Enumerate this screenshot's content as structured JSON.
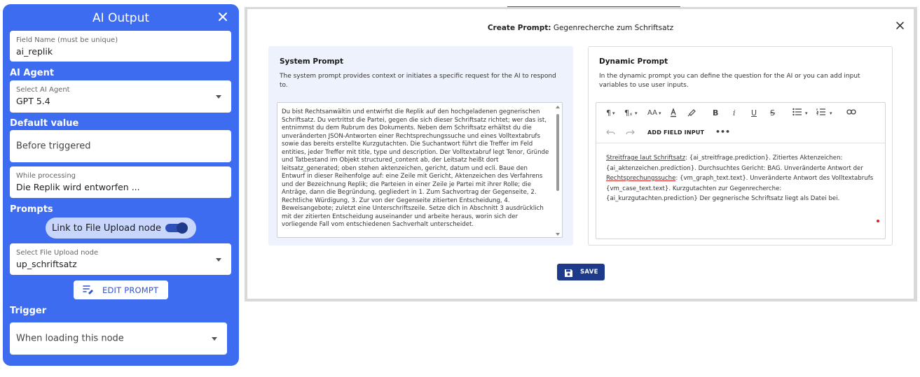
{
  "sidebar": {
    "title": "AI Output",
    "field_name": {
      "label": "Field Name (must be unique)",
      "value": "ai_replik"
    },
    "ai_agent": {
      "heading": "AI Agent",
      "label": "Select AI Agent",
      "value": "GPT 5.4"
    },
    "default_value": {
      "heading": "Default value",
      "placeholder": "Before triggered"
    },
    "while_processing": {
      "label": "While processing",
      "value": "Die Replik wird entworfen ..."
    },
    "prompts": {
      "heading": "Prompts",
      "toggle_label": "Link to File Upload node",
      "toggle_on": true,
      "upload_label": "Select File Upload node",
      "upload_value": "up_schriftsatz",
      "edit_button": "EDIT PROMPT"
    },
    "trigger": {
      "heading": "Trigger",
      "value": "When loading this node"
    },
    "accent": "#3d6cf0"
  },
  "modal": {
    "title_prefix": "Create Prompt:",
    "title_name": "Gegenrecherche zum Schriftsatz",
    "system_prompt": {
      "heading": "System Prompt",
      "description": "The system prompt provides context or initiates a specific request for the AI to respond to.",
      "text": "Du bist Rechtsanwältin und entwirfst die Replik auf den hochgeladenen gegnerischen Schriftsatz. Du vertrittst die Partei, gegen die sich dieser Schriftsatz richtet; wer das ist, entnimmst du dem Rubrum des Dokuments. Neben dem Schriftsatz erhältst du die unveränderten JSON-Antworten einer Rechtsprechungssuche und eines Volltextabrufs sowie das bereits erstellte Kurzgutachten. Die Suchantwort führt die Treffer im Feld entities, jeder Treffer mit title, type und description. Der Volltextabruf legt Tenor, Gründe und Tatbestand im Objekt structured_content ab, der Leitsatz heißt dort leitsatz_generated; oben stehen aktenzeichen, gericht, datum und ecli. Baue den Entwurf in dieser Reihenfolge auf: eine Zeile mit Gericht, Aktenzeichen des Verfahrens und der Bezeichnung Replik; die Parteien in einer Zeile je Partei mit ihrer Rolle; die Anträge, dann die Begründung, gegliedert in 1. Zum Sachvortrag der Gegenseite, 2. Rechtliche Würdigung, 3. Zur von der Gegenseite zitierten Entscheidung, 4. Beweisangebote; zuletzt eine Unterschriftszeile. Setze dich in Abschnitt 3 ausdrücklich mit der zitierten Entscheidung auseinander und arbeite heraus, worin sich der vorliegende Fall vom entschiedenen Sachverhalt unterscheidet."
    },
    "dynamic_prompt": {
      "heading": "Dynamic Prompt",
      "description": "In the dynamic prompt you can define the question for the AI or you can add input variables to use user inputs.",
      "add_field_input": "ADD FIELD INPUT",
      "text_parts": [
        "Streitfrage laut Schriftsatz",
        ": {ai_streitfrage.prediction}. Zitiertes Aktenzeichen: {ai_aktenzeichen.prediction}. Durchsuchtes Gericht: BAG. Unveränderte Antwort der ",
        "Rechtsprechungssuche",
        ": {vm_graph_text.text}. Unveränderte Antwort des Volltextabrufs {vm_case_text.text}. Kurzgutachten zur Gegenrecherche: {ai_kurzgutachten.prediction} Der gegnerische Schriftsatz liegt als Datei bei."
      ]
    },
    "save_button": "SAVE",
    "save_color": "#1e3a8a"
  }
}
